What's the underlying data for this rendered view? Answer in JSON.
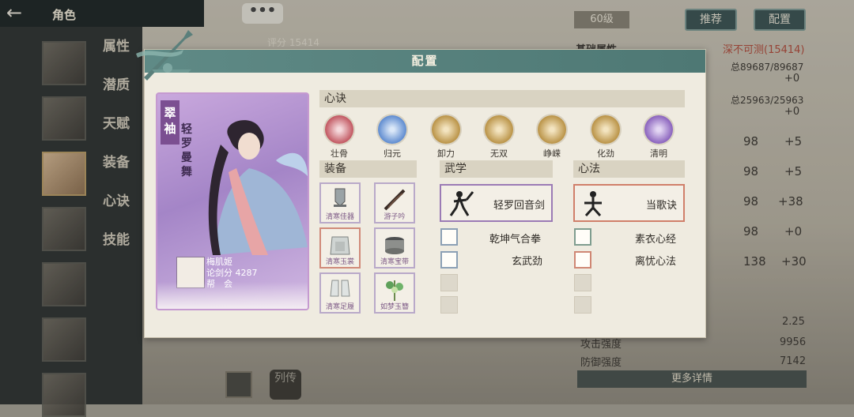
{
  "background": {
    "header": {
      "back": "←",
      "title": "角色"
    },
    "side_menu": [
      "属性",
      "潜质",
      "天赋",
      "装备",
      "心诀",
      "技能"
    ],
    "chat_button": "•••",
    "score_label": "评分 15414",
    "level": "60级",
    "buttons": {
      "recommend": "推荐",
      "config": "配置"
    },
    "basic_attr_title": "基础属性",
    "depth": "深不可测(15414)",
    "stats": [
      {
        "label": "总89687/89687",
        "value": "+0"
      },
      {
        "label": "总25963/25963",
        "value": "+0"
      }
    ],
    "attr_rows": [
      {
        "num": "98",
        "bonus": "+5"
      },
      {
        "num": "98",
        "bonus": "+5"
      },
      {
        "num": "98",
        "bonus": "+38"
      },
      {
        "num": "98",
        "bonus": "+0"
      },
      {
        "num": "138",
        "bonus": "+30"
      }
    ],
    "bottom_stats": [
      {
        "label": "",
        "value": "2.25"
      },
      {
        "label": "攻击强度",
        "value": "9956"
      },
      {
        "label": "防御强度",
        "value": "7142"
      }
    ],
    "more_details": "更多详情",
    "bottom_tab": "列传"
  },
  "dialog": {
    "title": "配置",
    "card": {
      "tag": "翠袖",
      "subtitle": "轻罗曼舞",
      "owner_name": "梅肌姬",
      "score": "论剑分 4287",
      "guild": "帮　会"
    },
    "xinjue": {
      "title": "心诀",
      "items": [
        {
          "name": "壮骨",
          "color": "#b9414c"
        },
        {
          "name": "归元",
          "color": "#4a7cc9"
        },
        {
          "name": "卸力",
          "color": "#b08532"
        },
        {
          "name": "无双",
          "color": "#b08532"
        },
        {
          "name": "峥嵘",
          "color": "#b08532"
        },
        {
          "name": "化劲",
          "color": "#b08532"
        },
        {
          "name": "清明",
          "color": "#7b4fb4"
        }
      ]
    },
    "equipment": {
      "title": "装备",
      "items": [
        {
          "name": "清寒佳器"
        },
        {
          "name": "游子吟"
        },
        {
          "name": "清寒玉裳"
        },
        {
          "name": "清寒宝带"
        },
        {
          "name": "清寒足履"
        },
        {
          "name": "如梦玉簪"
        }
      ]
    },
    "wuxue": {
      "title": "武学",
      "main": "轻罗回音剑",
      "subs": [
        "乾坤气合拳",
        "玄武劲"
      ]
    },
    "xinfa": {
      "title": "心法",
      "main": "当歌诀",
      "subs": [
        "素衣心经",
        "离忧心法"
      ]
    }
  }
}
